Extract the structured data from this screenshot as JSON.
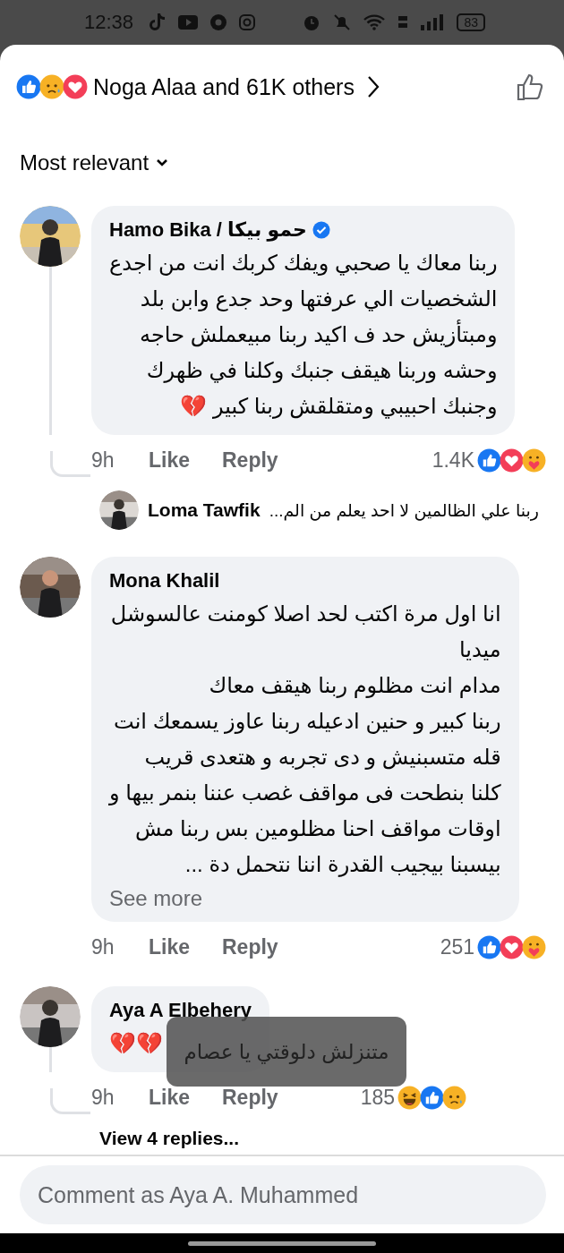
{
  "status_bar": {
    "time": "12:38",
    "battery": "83"
  },
  "header": {
    "reactions": [
      {
        "kind": "like"
      },
      {
        "kind": "sad"
      },
      {
        "kind": "love"
      }
    ],
    "summary": "Noga Alaa and 61K others"
  },
  "sort": {
    "label": "Most relevant"
  },
  "comments": [
    {
      "author": "Hamo Bika / حمو بيكا",
      "verified": true,
      "body": "ربنا معاك يا صحبي ويفك كربك انت من اجدع\nالشخصيات الي عرفتها وحد جدع وابن بلد\nومبتأزيش حد ف اكيد ربنا مبيعملش حاجه\nوحشه وربنا هيقف جنبك وكلنا في ظهرك\nوجنبك احبيبي ومتقلقش ربنا كبير 💔",
      "time": "9h",
      "like": "Like",
      "reply": "Reply",
      "count": "1.4K",
      "reactions": [
        {
          "kind": "like"
        },
        {
          "kind": "love"
        },
        {
          "kind": "care"
        }
      ],
      "replies": [
        {
          "author": "Loma Tawfik",
          "text": "ربنا علي الظالمين لا احد يعلم من الم..."
        }
      ]
    },
    {
      "author": "Mona Khalil",
      "verified": false,
      "body": "انا اول مرة اكتب لحد اصلا كومنت عالسوشل\nميديا\nمدام انت مظلوم ربنا هيقف معاك \nربنا كبير و حنين ادعيله ربنا عاوز يسمعك انت \nقله متسبنيش و دى تجربه و هتعدى قريب \nكلنا بنطحت فى مواقف غصب عننا بنمر بيها و\nاوقات مواقف احنا مظلومين بس ربنا مش\nبيسبنا بيجيب القدرة اننا نتحمل دة ...",
      "see_more": "See more",
      "time": "9h",
      "like": "Like",
      "reply": "Reply",
      "count": "251",
      "reactions": [
        {
          "kind": "like"
        },
        {
          "kind": "love"
        },
        {
          "kind": "care"
        }
      ]
    },
    {
      "author": "Aya A Elbehery",
      "verified": false,
      "body": "💔💔",
      "time": "9h",
      "like": "Like",
      "reply": "Reply",
      "count": "185",
      "reactions": [
        {
          "kind": "haha"
        },
        {
          "kind": "like"
        },
        {
          "kind": "sad"
        }
      ],
      "view_replies": "View 4 replies..."
    }
  ],
  "toast": {
    "text": "متنزلش دلوقتي يا عصام"
  },
  "composer": {
    "placeholder": "Comment as Aya A. Muhammed"
  }
}
